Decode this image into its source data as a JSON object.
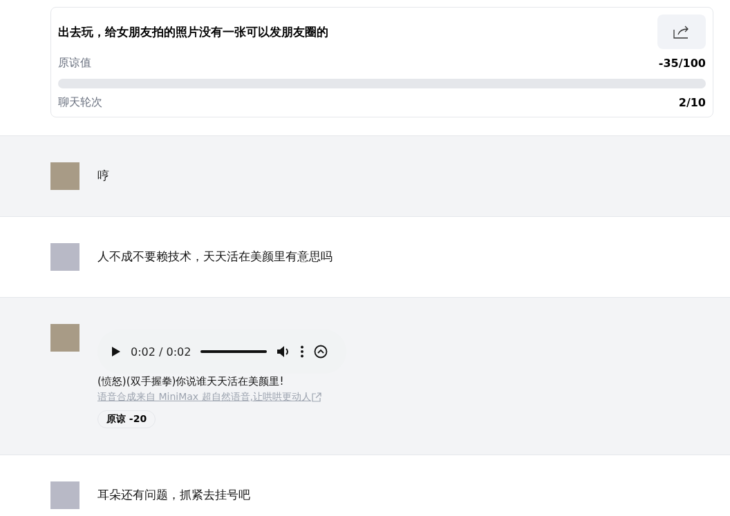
{
  "scenario": {
    "title": "出去玩，给女朋友拍的照片没有一张可以发朋友圈的",
    "forgiveness_label": "原谅值",
    "forgiveness_value": "-35/100",
    "level": 0,
    "rounds_label": "聊天轮次",
    "rounds_value": "2/10"
  },
  "messages": [
    {
      "shaded": true,
      "kind": "text",
      "text": "哼"
    },
    {
      "shaded": false,
      "kind": "text",
      "text": "人不成不要赖技术，天天活在美颜里有意思吗"
    },
    {
      "shaded": true,
      "kind": "voice",
      "audio": {
        "time": "0:02 / 0:02",
        "level": 1
      },
      "text": "(愤怒)(双手握拳)你说谁天天活在美颜里!",
      "credit": "语音合成来自 MiniMax 超自然语音,让哄哄更动人",
      "badge": "原谅 -20"
    },
    {
      "shaded": false,
      "kind": "text",
      "text": "耳朵还有问题，抓紧去挂号吧"
    }
  ]
}
